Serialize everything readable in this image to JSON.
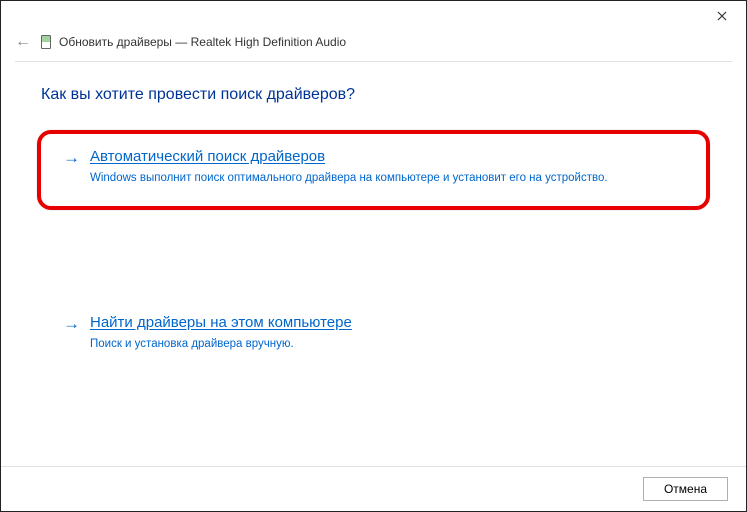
{
  "header": {
    "title": "Обновить драйверы — Realtek High Definition Audio"
  },
  "heading": "Как вы хотите провести поиск драйверов?",
  "options": {
    "auto": {
      "title": "Автоматический поиск драйверов",
      "desc": "Windows выполнит поиск оптимального драйвера на компьютере и установит его на устройство."
    },
    "manual": {
      "title": "Найти драйверы на этом компьютере",
      "desc": "Поиск и установка драйвера вручную."
    }
  },
  "footer": {
    "cancel": "Отмена"
  }
}
